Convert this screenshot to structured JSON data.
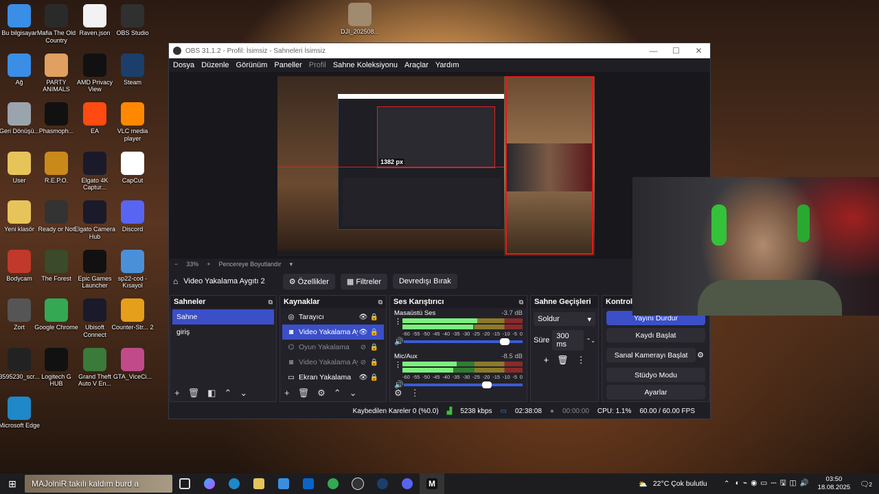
{
  "desktop": {
    "icons": [
      {
        "label": "Bu bilgisayar",
        "icon": "computer-icon",
        "color": "#3a8ee6"
      },
      {
        "label": "Mafia The Old Country",
        "icon": "mafia-icon",
        "color": "#2a2a2a"
      },
      {
        "label": "Raven.json",
        "icon": "file-icon",
        "color": "#f2f2f2"
      },
      {
        "label": "OBS Studio",
        "icon": "obs-icon",
        "color": "#303030"
      },
      {
        "label": "Ağ",
        "icon": "network-icon",
        "color": "#3a8ee6"
      },
      {
        "label": "PARTY ANIMALS",
        "icon": "party-animals-icon",
        "color": "#e0a060"
      },
      {
        "label": "AMD Privacy View",
        "icon": "amd-icon",
        "color": "#111111"
      },
      {
        "label": "Steam",
        "icon": "steam-icon",
        "color": "#1b3f6a"
      },
      {
        "label": "Geri Dönüşü...",
        "icon": "recycle-bin-icon",
        "color": "#9aa4ad"
      },
      {
        "label": "Phasmoph...",
        "icon": "phasmophobia-icon",
        "color": "#111111"
      },
      {
        "label": "EA",
        "icon": "ea-icon",
        "color": "#ff4a12"
      },
      {
        "label": "VLC media player",
        "icon": "vlc-icon",
        "color": "#ff8800"
      },
      {
        "label": "User",
        "icon": "user-folder-icon",
        "color": "#e6c45a"
      },
      {
        "label": "R.E.P.O.",
        "icon": "repo-icon",
        "color": "#c98a1a"
      },
      {
        "label": "Elgato 4K Captur...",
        "icon": "elgato-4k-icon",
        "color": "#1a1a2a"
      },
      {
        "label": "CapCut",
        "icon": "capcut-icon",
        "color": "#ffffff"
      },
      {
        "label": "Yeni klasör",
        "icon": "folder-icon",
        "color": "#e6c45a"
      },
      {
        "label": "Ready or Not",
        "icon": "ready-or-not-icon",
        "color": "#333333"
      },
      {
        "label": "Elgato Camera Hub",
        "icon": "camera-hub-icon",
        "color": "#1a1a2a"
      },
      {
        "label": "Discord",
        "icon": "discord-icon",
        "color": "#5865f2"
      },
      {
        "label": "Bodycam",
        "icon": "bodycam-icon",
        "color": "#c0392b"
      },
      {
        "label": "The Forest",
        "icon": "the-forest-icon",
        "color": "#3a4a2a"
      },
      {
        "label": "Epic Games Launcher",
        "icon": "epic-games-icon",
        "color": "#111111"
      },
      {
        "label": "sp22-cod - Kısayol",
        "icon": "shortcut-icon",
        "color": "#4a90d9"
      },
      {
        "label": "Zort",
        "icon": "zort-icon",
        "color": "#555555"
      },
      {
        "label": "Google Chrome",
        "icon": "chrome-icon",
        "color": "#34a853"
      },
      {
        "label": "Ubisoft Connect",
        "icon": "ubisoft-icon",
        "color": "#1a1a2a"
      },
      {
        "label": "Counter-Str... 2",
        "icon": "cs2-icon",
        "color": "#e59f1a"
      },
      {
        "label": "3595230_scr...",
        "icon": "screenshot-file-icon",
        "color": "#222222"
      },
      {
        "label": "Logitech G HUB",
        "icon": "logitech-icon",
        "color": "#111111"
      },
      {
        "label": "Grand Theft Auto V En...",
        "icon": "gta-icon",
        "color": "#3a7a3a"
      },
      {
        "label": "GTA_ViceCi...",
        "icon": "gta-vice-icon",
        "color": "#c04a8a"
      },
      {
        "label": "Microsoft Edge",
        "icon": "edge-icon",
        "color": "#1e88c8"
      },
      {
        "label": "DJI_202508...",
        "icon": "video-file-icon",
        "color": "#a08a70"
      }
    ]
  },
  "obs": {
    "title": "OBS 31.1.2 - Profil: İsimsiz - Sahneleri İsimsiz",
    "menu": [
      "Dosya",
      "Düzenle",
      "Görünüm",
      "Paneller",
      "Profil",
      "Sahne Koleksiyonu",
      "Araçlar",
      "Yardım"
    ],
    "preview": {
      "size_label": "1382 px",
      "zoom": "33%",
      "fit_label": "Pencereye Boyutlandır"
    },
    "source_bar": {
      "source_name": "Video Yakalama Aygıtı 2",
      "properties": "Özellikler",
      "filters": "Filtreler",
      "deactivate": "Devredışı Bırak"
    },
    "scenes": {
      "title": "Sahneler",
      "items": [
        "Sahne",
        "giriş"
      ]
    },
    "sources": {
      "title": "Kaynaklar",
      "items": [
        {
          "name": "Tarayıcı",
          "icon": "browser-icon",
          "visible": true,
          "selected": false
        },
        {
          "name": "Video Yakalama Ay",
          "icon": "camera-icon",
          "visible": true,
          "selected": true
        },
        {
          "name": "Oyun Yakalama",
          "icon": "gamepad-icon",
          "visible": false,
          "selected": false
        },
        {
          "name": "Video Yakalama Ay",
          "icon": "camera-icon",
          "visible": false,
          "selected": false
        },
        {
          "name": "Ekran Yakalama",
          "icon": "monitor-icon",
          "visible": true,
          "selected": false
        }
      ]
    },
    "mixer": {
      "title": "Ses Karıştırıcı",
      "channels": [
        {
          "name": "Masaüstü Ses",
          "db": "-3.7 dB",
          "level": 0.62,
          "volume": 0.85
        },
        {
          "name": "Mic/Aux",
          "db": "-8.5 dB",
          "level": 0.45,
          "volume": 0.7
        }
      ],
      "ticks": [
        "-60",
        "-55",
        "-50",
        "-45",
        "-40",
        "-35",
        "-30",
        "-25",
        "-20",
        "-15",
        "-10",
        "-5",
        "0"
      ]
    },
    "transitions": {
      "title": "Sahne Geçişleri",
      "type": "Soldur",
      "duration_label": "Süre",
      "duration": "300 ms"
    },
    "controls": {
      "title": "Kontroller",
      "buttons": [
        "Yayını Durdur",
        "Kaydı Başlat",
        "Sanal Kamerayı Başlat",
        "Stüdyo Modu",
        "Ayarlar"
      ]
    },
    "status": {
      "dropped": "Kaybedilen Kareler 0 (%0.0)",
      "bitrate": "5238 kbps",
      "stream_time": "02:38:08",
      "rec_time": "00:00:00",
      "cpu": "CPU: 1.1%",
      "fps": "60.00 / 60.00 FPS"
    }
  },
  "taskbar": {
    "search_text": "MAJolniR takılı kaldım burd a",
    "weather": "22°C  Çok bulutlu",
    "time": "03:50",
    "date": "18.08.2025",
    "notification_count": "2"
  }
}
